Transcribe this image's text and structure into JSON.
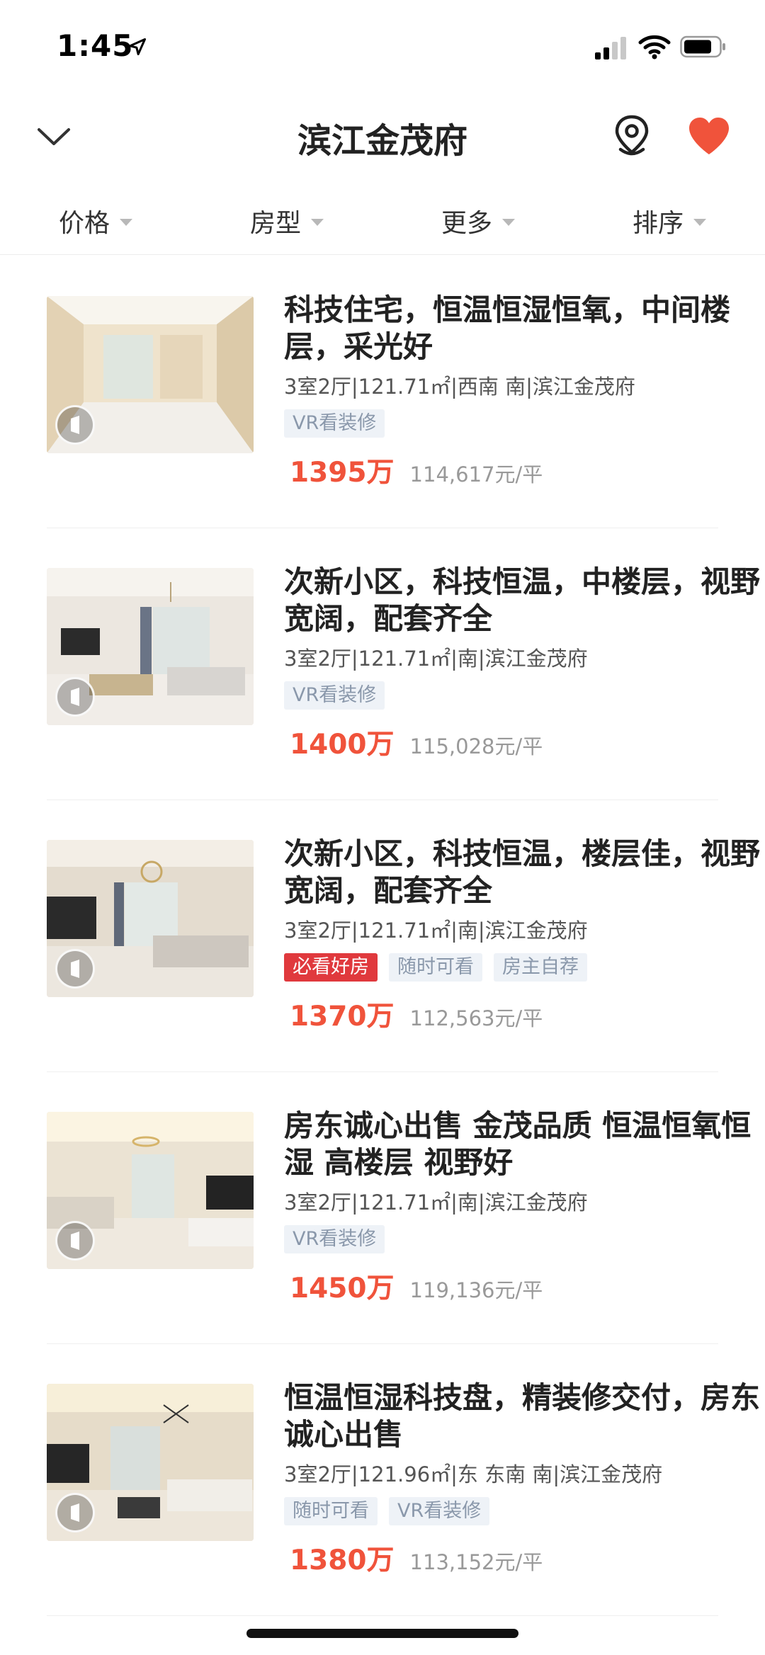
{
  "status_bar": {
    "time": "1:45"
  },
  "header": {
    "title": "滨江金茂府",
    "heart_color": "#f0533b"
  },
  "filters": [
    {
      "label": "价格"
    },
    {
      "label": "房型"
    },
    {
      "label": "更多"
    },
    {
      "label": "排序"
    }
  ],
  "listings": [
    {
      "title": "科技住宅，恒温恒湿恒氧，中间楼层，采光好",
      "specs": "3室2厅|121.71㎡|西南 南|滨江金茂府",
      "tags": [
        "VR看装修"
      ],
      "price": "1395万",
      "unit_price": "114,617元/平"
    },
    {
      "title": "次新小区，科技恒温，中楼层，视野宽阔，配套齐全",
      "specs": "3室2厅|121.71㎡|南|滨江金茂府",
      "tags": [
        "VR看装修"
      ],
      "price": "1400万",
      "unit_price": "115,028元/平"
    },
    {
      "title": "次新小区，科技恒温，楼层佳，视野宽阔，配套齐全",
      "specs": "3室2厅|121.71㎡|南|滨江金茂府",
      "tags": [
        "必看好房",
        "随时可看",
        "房主自荐"
      ],
      "price": "1370万",
      "unit_price": "112,563元/平"
    },
    {
      "title": "房东诚心出售 金茂品质 恒温恒氧恒湿 高楼层 视野好",
      "specs": "3室2厅|121.71㎡|南|滨江金茂府",
      "tags": [
        "VR看装修"
      ],
      "price": "1450万",
      "unit_price": "119,136元/平"
    },
    {
      "title": "恒温恒湿科技盘，精装修交付，房东诚心出售",
      "specs": "3室2厅|121.96㎡|东 东南 南|滨江金茂府",
      "tags": [
        "随时可看",
        "VR看装修"
      ],
      "price": "1380万",
      "unit_price": "113,152元/平"
    }
  ]
}
